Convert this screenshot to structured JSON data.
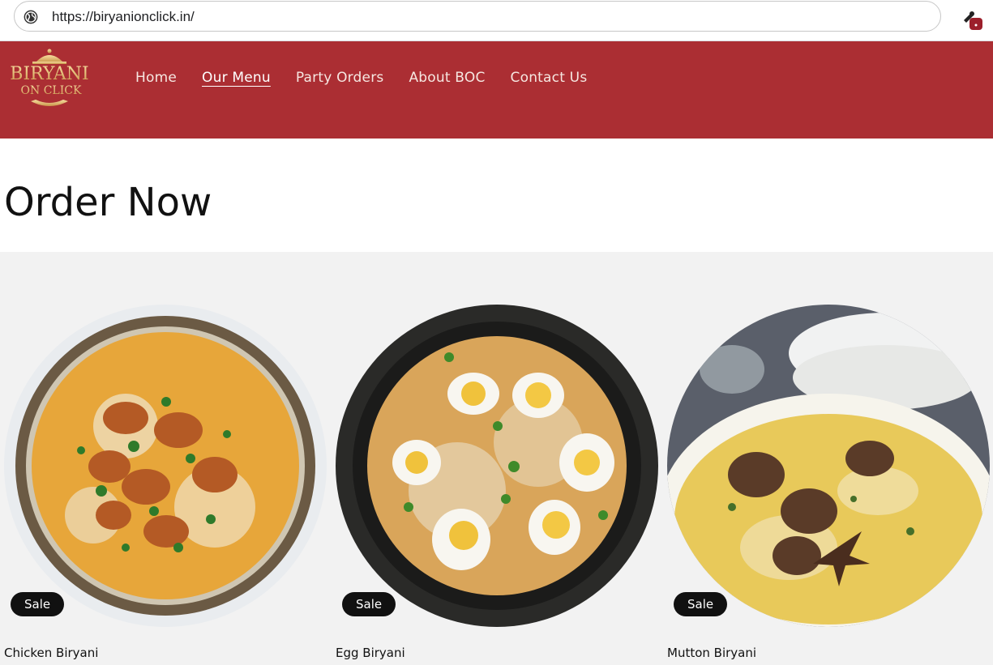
{
  "browser": {
    "url": "https://biryanionclick.in/"
  },
  "header": {
    "logo_line1": "BIRYANI",
    "logo_line2": "ON CLICK",
    "nav": [
      {
        "label": "Home",
        "active": false
      },
      {
        "label": "Our Menu",
        "active": true
      },
      {
        "label": "Party Orders",
        "active": false
      },
      {
        "label": "About BOC",
        "active": false
      },
      {
        "label": "Contact Us",
        "active": false
      }
    ],
    "brand_color": "#ab2e33"
  },
  "main": {
    "title": "Order Now",
    "products": [
      {
        "name": "Chicken Biryani",
        "badge": "Sale"
      },
      {
        "name": "Egg Biryani",
        "badge": "Sale"
      },
      {
        "name": "Mutton Biryani",
        "badge": "Sale"
      }
    ]
  }
}
